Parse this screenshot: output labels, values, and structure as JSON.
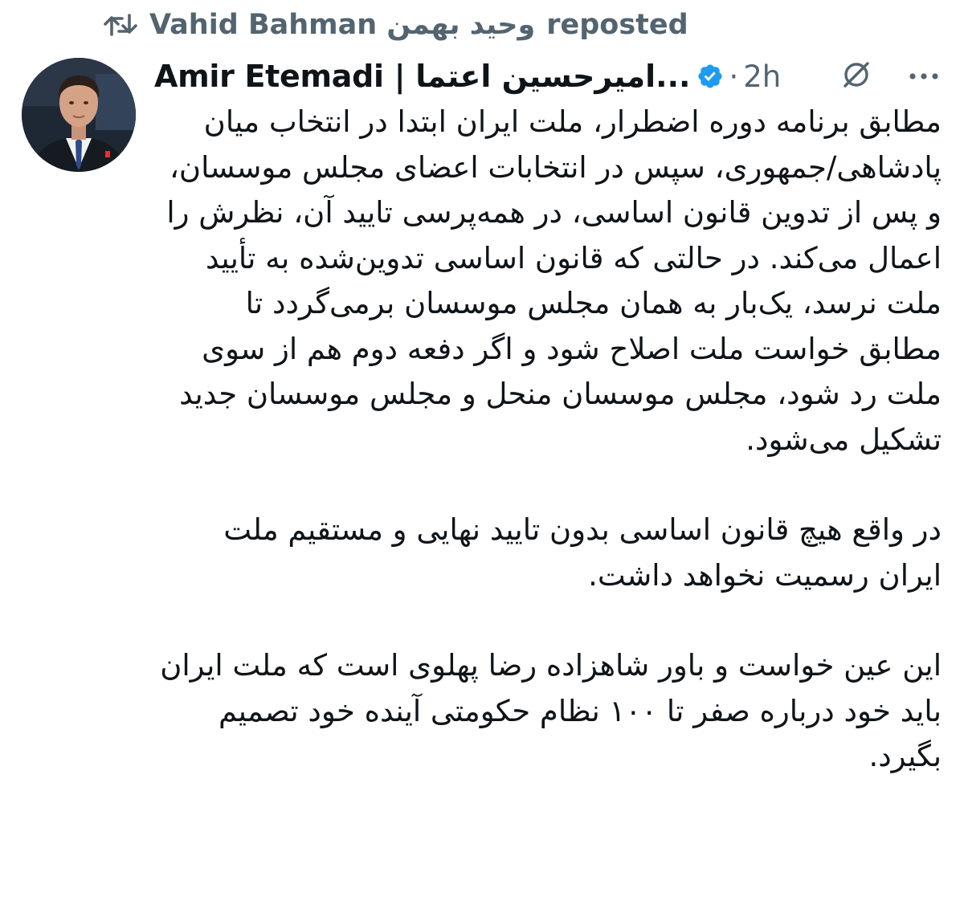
{
  "repost": {
    "user": "Vahid Bahman وحید بهمن",
    "label": "reposted"
  },
  "tweet": {
    "author_name": "Amir Etemadi | اميرحسين اعتما...",
    "separator": "·",
    "time": "2h",
    "icons": [
      "repost-icon",
      "verified-badge-icon",
      "grok-icon",
      "more-icon"
    ],
    "paragraphs": [
      "مطابق برنامه دوره اضطرار، ملت ایران ابتدا در انتخاب میان پادشاهی/جمهوری، سپس در انتخابات اعضای مجلس موسسان، و پس از تدوین قانون اساسی، در همه‌پرسی تایید آن، نظرش را اعمال می‌کند. در حالتی که قانون اساسی تدوین‌شده به تأیید ملت نرسد، یک‌بار به همان مجلس موسسان برمی‌گردد تا مطابق خواست ملت اصلاح شود و اگر دفعه دوم هم از سوی ملت رد شود، مجلس موسسان منحل و مجلس موسسان جدید تشکیل می‌شود.",
      "در واقع هیچ قانون اساسی بدون تایید نهایی و مستقیم ملت ایران رسمیت نخواهد داشت.",
      "این عین خواست و باور شاهزاده رضا پهلوی است که ملت ایران باید خود درباره صفر تا ۱۰۰ نظام حکومتی آینده خود تصمیم بگیرد."
    ]
  },
  "colors": {
    "text": "#0f1419",
    "secondary": "#536471",
    "verified": "#1d9bf0",
    "background": "#ffffff"
  }
}
